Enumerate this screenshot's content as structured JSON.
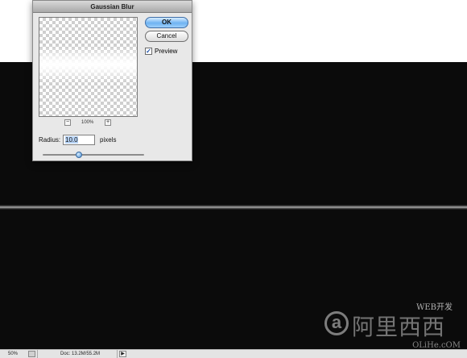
{
  "dialog": {
    "title": "Gaussian Blur",
    "ok_label": "OK",
    "cancel_label": "Cancel",
    "preview_label": "Preview",
    "preview_checked": true,
    "zoom_minus": "−",
    "zoom_plus": "+",
    "zoom_percent": "100%",
    "radius_label": "Radius:",
    "radius_value": "10.0",
    "radius_unit": "pixels",
    "slider_fraction": 0.36
  },
  "statusbar": {
    "zoom": "50%",
    "doc_info": "Doc: 13.2M/55.2M",
    "menu_arrow": "▶"
  },
  "watermark": {
    "top_text": "WEB开发",
    "logo_letter": "a",
    "main_text": "阿里西西",
    "sub_text": "OLiHe.cOM"
  },
  "colors": {
    "canvas": "#0b0b0b",
    "ok_button": "#6fb3f2",
    "dialog_bg": "#e8e8e8"
  }
}
